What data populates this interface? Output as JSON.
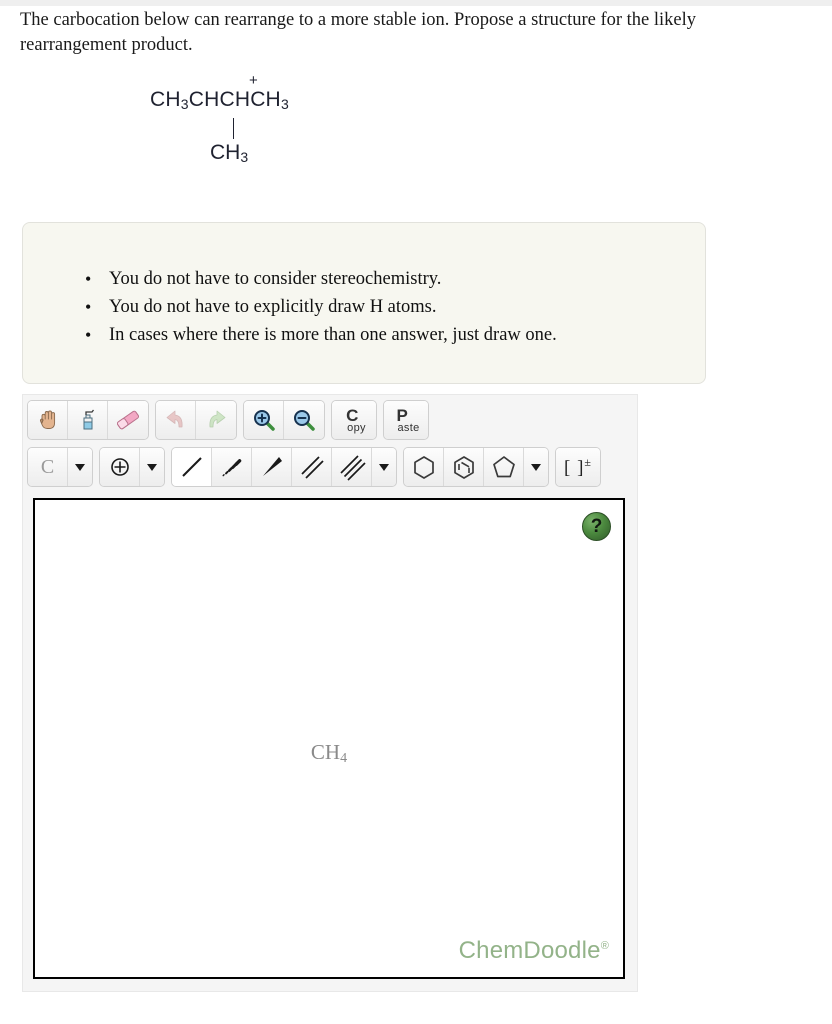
{
  "prompt": {
    "text": "The carbocation below can rearrange to a more stable ion. Propose a structure for the likely rearrangement product."
  },
  "structure": {
    "charge": "+",
    "main_chain": "CH₃CHCHCH₃",
    "main_parts": [
      {
        "text": "CH",
        "sub": "3"
      },
      {
        "text": "CHCHCH",
        "sub": "3"
      }
    ],
    "branch": {
      "text": "CH",
      "sub": "3"
    }
  },
  "instructions": {
    "items": [
      "You do not have to consider stereochemistry.",
      "You do not have to explicitly draw H atoms.",
      "In cases where there is more than one answer, just draw one."
    ]
  },
  "sketcher": {
    "toolbar_row1": [
      {
        "name": "pan-hand-tool",
        "icon": "hand-icon",
        "label": ""
      },
      {
        "name": "clear-tool",
        "icon": "spray-bottle-icon",
        "label": ""
      },
      {
        "name": "eraser-tool",
        "icon": "eraser-icon",
        "label": ""
      },
      {
        "name": "undo-button",
        "icon": "undo-arrow-icon",
        "label": ""
      },
      {
        "name": "redo-button",
        "icon": "redo-arrow-icon",
        "label": ""
      },
      {
        "name": "zoom-in-button",
        "icon": "magnifier-plus-icon",
        "label": ""
      },
      {
        "name": "zoom-out-button",
        "icon": "magnifier-minus-icon",
        "label": ""
      },
      {
        "name": "copy-button",
        "icon": "copy-icon",
        "label": "Copy"
      },
      {
        "name": "paste-button",
        "icon": "paste-icon",
        "label": "Paste"
      }
    ],
    "copy_label": {
      "big": "C",
      "small": "opy"
    },
    "paste_label": {
      "big": "P",
      "small": "aste"
    },
    "element_label": "C",
    "charge_tool_label": "⊕",
    "bracket_tool": {
      "brackets": "[ ]",
      "charge": "±"
    },
    "toolbar_row2": [
      {
        "name": "element-label-tool",
        "icon": "carbon-label-icon"
      },
      {
        "name": "element-dropdown",
        "icon": "chevron-down-icon"
      },
      {
        "name": "charge-tool",
        "icon": "plus-circle-icon"
      },
      {
        "name": "charge-dropdown",
        "icon": "chevron-down-icon"
      },
      {
        "name": "single-bond-tool",
        "icon": "single-bond-icon"
      },
      {
        "name": "hashed-wedge-bond-tool",
        "icon": "hashed-wedge-icon"
      },
      {
        "name": "solid-wedge-bond-tool",
        "icon": "solid-wedge-icon"
      },
      {
        "name": "double-bond-tool",
        "icon": "double-bond-icon"
      },
      {
        "name": "triple-bond-tool",
        "icon": "triple-bond-icon"
      },
      {
        "name": "bond-dropdown",
        "icon": "chevron-down-icon"
      },
      {
        "name": "cyclohexane-ring-tool",
        "icon": "hexagon-icon"
      },
      {
        "name": "benzene-ring-tool",
        "icon": "benzene-icon"
      },
      {
        "name": "cyclopentane-ring-tool",
        "icon": "pentagon-icon"
      },
      {
        "name": "ring-dropdown",
        "icon": "chevron-down-icon"
      },
      {
        "name": "bracket-charge-tool",
        "icon": "bracket-charge-icon"
      }
    ],
    "canvas": {
      "molecule_label": {
        "text": "CH",
        "sub": "4"
      },
      "help_label": "?",
      "watermark": "ChemDoodle",
      "watermark_mark": "®"
    }
  },
  "colors": {
    "page_background": "#ffffff",
    "callout_background": "#f7f7f0",
    "callout_border": "#e2e2dc",
    "toolbar_background": "#f5f5f5",
    "canvas_border": "#000000",
    "help_green": "#4c8a3f",
    "watermark_green": "#93b389",
    "molecule_label_gray": "#8a8a8a"
  }
}
